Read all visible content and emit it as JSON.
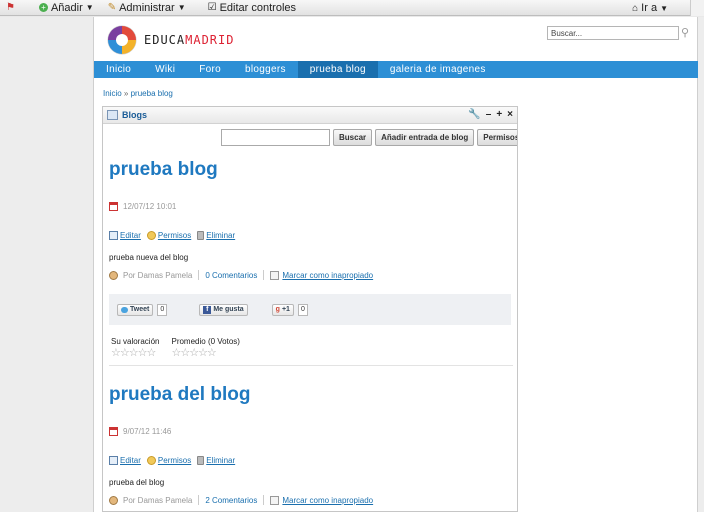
{
  "dockbar": {
    "add": "Añadir",
    "admin": "Administrar",
    "edit_controls": "Editar controles",
    "goto": "Ir a"
  },
  "header": {
    "logo_prefix": "EDUCA",
    "logo_suffix": "MADRID",
    "search_value": "Buscar..."
  },
  "nav": {
    "items": [
      "Inicio",
      "Wiki",
      "Foro",
      "bloggers",
      "prueba blog",
      "galeria de imagenes"
    ],
    "active_index": 4
  },
  "breadcrumb": {
    "home": "Inicio",
    "sep": "»",
    "current": "prueba blog"
  },
  "portlet": {
    "title": "Blogs",
    "toolbar": {
      "search_label": "Buscar",
      "add_entry_label": "Añadir entrada de blog",
      "permissions_label": "Permisos"
    }
  },
  "entries": [
    {
      "title": "prueba blog",
      "date": "12/07/12 10:01",
      "edit": "Editar",
      "permissions": "Permisos",
      "delete": "Eliminar",
      "body": "prueba nueva del blog",
      "author": "Por Damas Pamela",
      "comments": "0 Comentarios",
      "flag": "Marcar como inapropiado",
      "tweet_label": "Tweet",
      "tweet_count": "0",
      "fb_label": "Me gusta",
      "gplus_label": "+1",
      "gplus_count": "0",
      "your_rating": "Su valoración",
      "average": "Promedio (0 Votos)"
    },
    {
      "title": "prueba del blog",
      "date": "9/07/12 11:46",
      "edit": "Editar",
      "permissions": "Permisos",
      "delete": "Eliminar",
      "body": "prueba del blog",
      "author": "Por Damas Pamela",
      "comments": "2 Comentarios",
      "flag": "Marcar como inapropiado"
    }
  ],
  "colors": {
    "nav_bg": "#2d8fd5",
    "nav_active": "#1a6fae",
    "title_blue": "#1f79c0"
  }
}
